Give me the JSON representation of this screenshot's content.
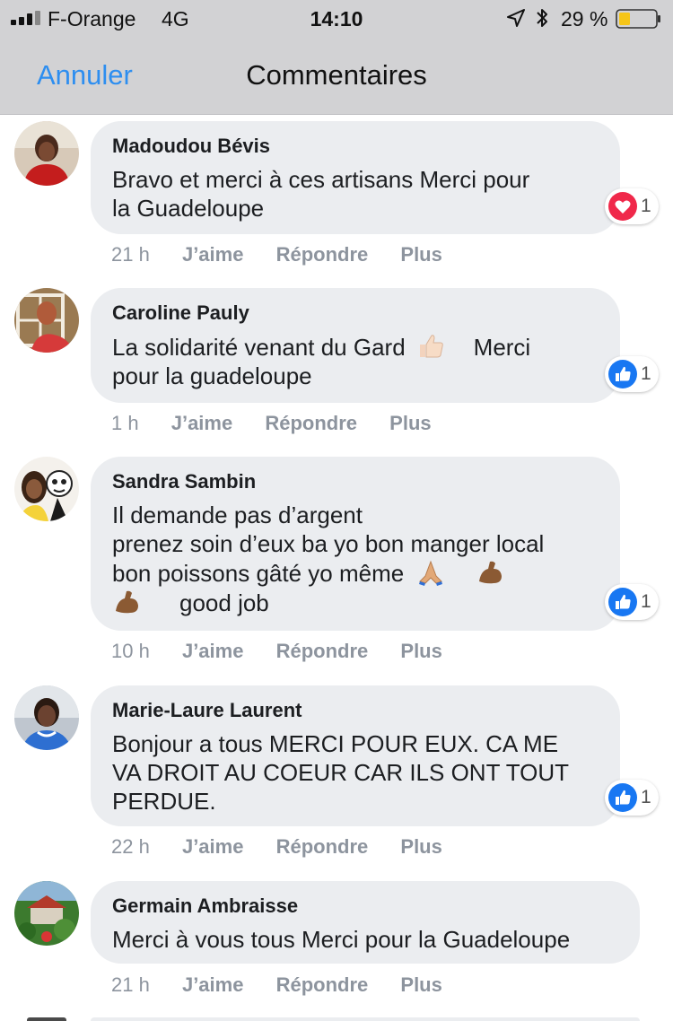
{
  "status_bar": {
    "carrier": "F-Orange",
    "network": "4G",
    "time": "14:10",
    "battery": "29 %"
  },
  "nav": {
    "cancel": "Annuler",
    "title": "Commentaires"
  },
  "actions_labels": {
    "like": "J’aime",
    "reply": "Répondre",
    "more": "Plus"
  },
  "comments": [
    {
      "author": "Madoudou Bévis",
      "lines": [
        "Bravo et merci à ces artisans Merci pour",
        "la Guadeloupe"
      ],
      "time": "21 h",
      "reaction": {
        "type": "heart-icon",
        "count": "1",
        "color": "#f0284a"
      }
    },
    {
      "author": "Caroline Pauly",
      "lines": [
        "La solidarité venant du Gard",
        "Merci",
        "pour la guadeloupe"
      ],
      "time": "1 h",
      "reaction": {
        "type": "like-icon",
        "count": "1",
        "color": "#1877f2"
      }
    },
    {
      "author": "Sandra Sambin",
      "lines": [
        "Il demande pas d’argent",
        "prenez soin d’eux ba yo bon manger local",
        "bon poissons gâté yo même",
        "good job"
      ],
      "time": "10 h",
      "reaction": {
        "type": "like-icon",
        "count": "1",
        "color": "#1877f2"
      }
    },
    {
      "author": "Marie-Laure Laurent",
      "lines": [
        "Bonjour a tous MERCI POUR EUX. CA ME",
        "VA DROIT AU COEUR CAR ILS ONT TOUT",
        "PERDUE."
      ],
      "time": "22 h",
      "reaction": {
        "type": "like-icon",
        "count": "1",
        "color": "#1877f2"
      }
    },
    {
      "author": "Germain Ambraisse",
      "lines": [
        "Merci à vous tous Merci pour la Guadeloupe"
      ],
      "time": "21 h"
    }
  ],
  "colors": {
    "accent": "#2d8ef0",
    "bubble": "#ebedf0",
    "meta": "#8d949e",
    "bar": "#d2d2d4",
    "battery_fill": "#f5c518"
  }
}
